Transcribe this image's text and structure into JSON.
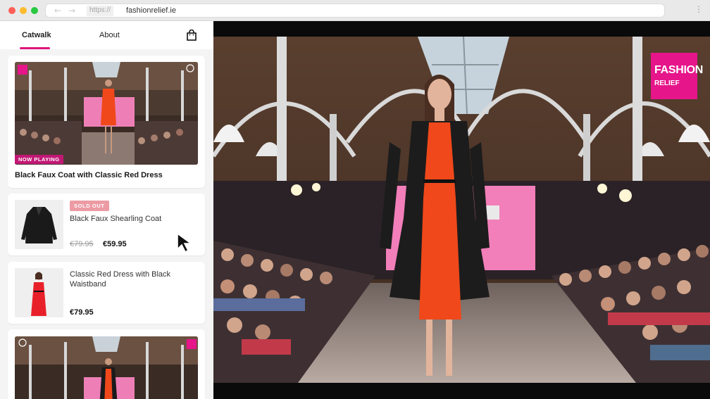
{
  "browser": {
    "scheme": "https://",
    "host": "fashionrelief.ie"
  },
  "nav": {
    "tabs": [
      "Catwalk",
      "About"
    ],
    "active_tab": "Catwalk"
  },
  "now_playing": {
    "badge": "NOW PLAYING",
    "title": "Black Faux Coat with Classic Red Dress"
  },
  "products": [
    {
      "name": "Black Faux Shearling Coat",
      "badge": "SOLD OUT",
      "old_price": "€79.95",
      "price": "€59.95"
    },
    {
      "name": "Classic Red Dress with Black Waistband",
      "price": "€79.95"
    }
  ],
  "logo": {
    "line1": "FASHION",
    "line2": "RELIEF"
  },
  "colors": {
    "accent": "#e0157e",
    "now_playing_badge": "#c21875",
    "sold_out_badge": "#ec9ba4",
    "logo_bg": "#e6158a",
    "dress": "#f0481a"
  }
}
